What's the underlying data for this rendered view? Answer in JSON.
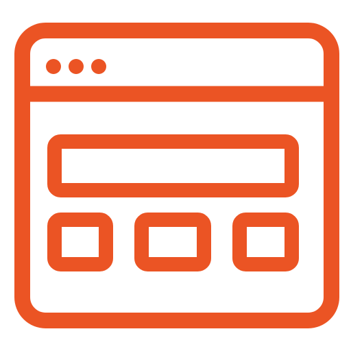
{
  "icon": {
    "name": "browser-window-layout-icon",
    "stroke_color": "#EB5424",
    "background_color": "#FFFFFF"
  },
  "window": {
    "title_bar_dots": [
      "dot-1",
      "dot-2",
      "dot-3"
    ]
  },
  "content": {
    "wide_block": "banner-block",
    "small_blocks": [
      "block-left",
      "block-center",
      "block-right"
    ]
  }
}
